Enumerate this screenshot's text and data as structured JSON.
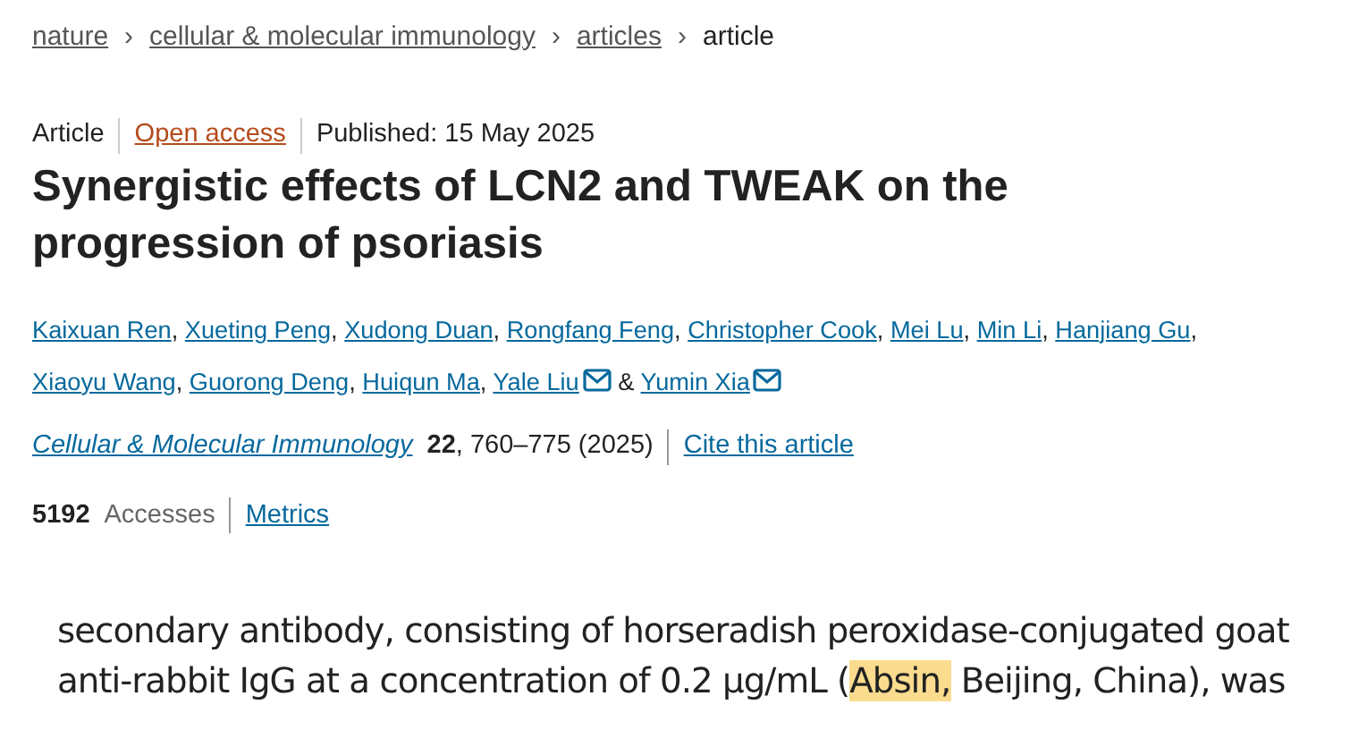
{
  "breadcrumb": [
    {
      "label": "nature",
      "current": false
    },
    {
      "label": "cellular & molecular immunology",
      "current": false
    },
    {
      "label": "articles",
      "current": false
    },
    {
      "label": "article",
      "current": true
    }
  ],
  "breadcrumb_separator": "›",
  "meta": {
    "type": "Article",
    "access": "Open access",
    "published": "Published: 15 May 2025"
  },
  "title": "Synergistic effects of LCN2 and TWEAK on the progression of psoriasis",
  "authors": [
    {
      "name": "Kaixuan Ren",
      "email": false,
      "separator": ","
    },
    {
      "name": "Xueting Peng",
      "email": false,
      "separator": ","
    },
    {
      "name": "Xudong Duan",
      "email": false,
      "separator": ","
    },
    {
      "name": "Rongfang Feng",
      "email": false,
      "separator": ","
    },
    {
      "name": "Christopher Cook",
      "email": false,
      "separator": ","
    },
    {
      "name": "Mei Lu",
      "email": false,
      "separator": ","
    },
    {
      "name": "Min Li",
      "email": false,
      "separator": ","
    },
    {
      "name": "Hanjiang Gu",
      "email": false,
      "separator": ","
    },
    {
      "name": "Xiaoyu Wang",
      "email": false,
      "separator": ","
    },
    {
      "name": "Guorong Deng",
      "email": false,
      "separator": ","
    },
    {
      "name": "Huiqun Ma",
      "email": false,
      "separator": ","
    },
    {
      "name": "Yale Liu",
      "email": true,
      "separator": "&"
    },
    {
      "name": "Yumin Xia",
      "email": true
    }
  ],
  "citation": {
    "journal": "Cellular & Molecular Immunology",
    "volume": "22",
    "pages": ", 760–775 (2025)",
    "cite_link": "Cite this article"
  },
  "stats": {
    "count": "5192",
    "label": "Accesses",
    "metrics_link": "Metrics"
  },
  "excerpt_lines": [
    [
      {
        "text": "secondary antibody, consisting of horseradish peroxidase-conjugated goat",
        "highlighted": false
      }
    ],
    [
      {
        "text": "anti-rabbit IgG at a concentration of 0.2 µg/mL (",
        "highlighted": false
      },
      {
        "text": "Absin,",
        "highlighted": true
      },
      {
        "text": " Beijing, China), was",
        "highlighted": false
      }
    ]
  ]
}
